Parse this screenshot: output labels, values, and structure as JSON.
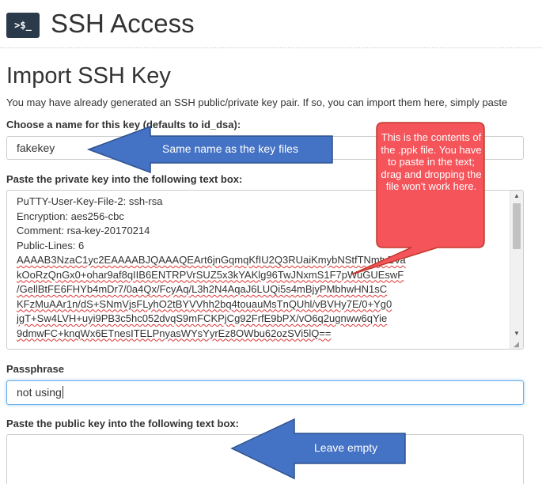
{
  "header": {
    "icon_text": ">$_",
    "title": "SSH Access"
  },
  "section": {
    "title": "Import SSH Key",
    "intro": "You may have already generated an SSH public/private key pair. If so, you can import them here, simply paste"
  },
  "name_field": {
    "label": "Choose a name for this key (defaults to id_dsa):",
    "value": "fakekey"
  },
  "private_key": {
    "label": "Paste the private key into the following text box:",
    "lines": [
      "PuTTY-User-Key-File-2: ssh-rsa",
      "Encryption: aes256-cbc",
      "Comment: rsa-key-20170214",
      "Public-Lines: 6",
      "AAAAB3NzaC1yc2EAAAABJQAAAQEArt6jnGqmqKfIU2Q3RUaiKmybNStfTNmtvZVa",
      "kOoRzQnGx0+ohar9af8qIIB6ENTRPVrSUZ5x3kYAKlg96TwJNxmS1F7pWuGUEswF",
      "/GellBtFE6FHYb4mDr7/0a4Qx/FcyAq/L3h2N4AqaJ6LUQi5s4mBjyPMbhwHN1sC",
      "KFzMuAAr1n/dS+SNmVjsFLyhO2tBYVVhh2bq4touauMsTnQUhl/vBVHy7E/0+Yg0",
      "jgT+Sw4LVH+uyi9PB3c5hc052dvqS9mFCKPjCg92FrfE9bPX/vO6q2ugnww6qYie",
      "9dmwFC+knqWx6ETnesITELPnyasWYsYyrEz8OWbu62ozSVi5lQ=="
    ]
  },
  "passphrase": {
    "label": "Passphrase",
    "value": "not using"
  },
  "public_key": {
    "label": "Paste the public key into the following text box:"
  },
  "annotations": {
    "name_arrow": "Same name as the key files",
    "callout": "This is the contents of the .ppk file.  You have to paste in the text; drag and dropping the file won't work here.",
    "public_arrow": "Leave empty"
  },
  "colors": {
    "annotation_blue": "#4472c4",
    "annotation_blue_border": "#2f528f",
    "callout_red": "#f4545a",
    "callout_border": "#c0392b",
    "focus_border": "#66afe9"
  }
}
